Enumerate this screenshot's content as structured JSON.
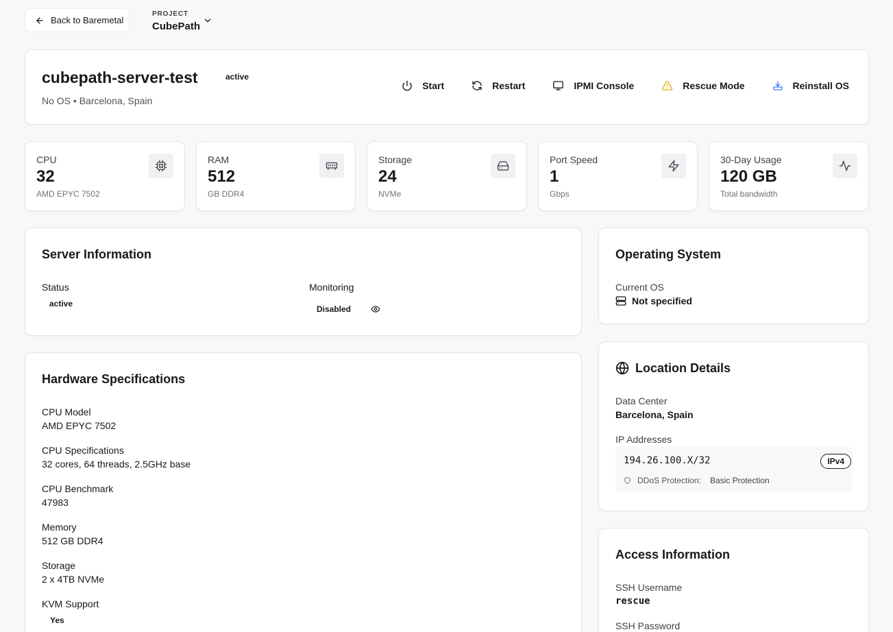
{
  "topbar": {
    "back_label": "Back to Baremetal",
    "project_label": "PROJECT",
    "project_name": "CubePath"
  },
  "server": {
    "name": "cubepath-server-test",
    "status": "active",
    "subtitle": "No OS • Barcelona, Spain"
  },
  "actions": [
    {
      "label": "Start",
      "icon": "power-icon"
    },
    {
      "label": "Restart",
      "icon": "refresh-icon"
    },
    {
      "label": "IPMI Console",
      "icon": "monitor-icon"
    },
    {
      "label": "Rescue Mode",
      "icon": "warning-icon"
    },
    {
      "label": "Reinstall OS",
      "icon": "download-icon"
    }
  ],
  "stats": [
    {
      "label": "CPU",
      "value": "32",
      "sub": "AMD EPYC 7502",
      "icon": "cpu-icon"
    },
    {
      "label": "RAM",
      "value": "512",
      "sub": "GB DDR4",
      "icon": "memory-icon"
    },
    {
      "label": "Storage",
      "value": "24",
      "sub": "NVMe",
      "icon": "hard-drive-icon"
    },
    {
      "label": "Port Speed",
      "value": "1",
      "sub": "Gbps",
      "icon": "lightning-icon"
    },
    {
      "label": "30-Day Usage",
      "value": "120 GB",
      "sub": "Total bandwidth",
      "icon": "activity-icon"
    }
  ],
  "server_info": {
    "title": "Server Information",
    "status_label": "Status",
    "status_value": "active",
    "monitoring_label": "Monitoring",
    "monitoring_value": "Disabled"
  },
  "hardware": {
    "title": "Hardware Specifications",
    "fields": [
      {
        "label": "CPU Model",
        "value": "AMD EPYC 7502"
      },
      {
        "label": "CPU Specifications",
        "value": "32 cores, 64 threads, 2.5GHz base"
      },
      {
        "label": "CPU Benchmark",
        "value": "47983"
      },
      {
        "label": "Memory",
        "value": "512 GB DDR4"
      },
      {
        "label": "Storage",
        "value": "2 x 4TB NVMe"
      },
      {
        "label": "KVM Support",
        "value": "Yes"
      }
    ]
  },
  "os": {
    "title": "Operating System",
    "current_label": "Current OS",
    "current_value": "Not specified"
  },
  "location": {
    "title": "Location Details",
    "dc_label": "Data Center",
    "dc_value": "Barcelona, Spain",
    "ip_label": "IP Addresses",
    "ip_value": "194.26.100.X/32",
    "ip_type": "IPv4",
    "ddos_label": "DDoS Protection:",
    "ddos_value": "Basic Protection"
  },
  "access": {
    "title": "Access Information",
    "ssh_user_label": "SSH Username",
    "ssh_user_value": "rescue",
    "ssh_pass_label": "SSH Password"
  },
  "colors": {
    "background": "#f8f8f9",
    "warning": "#eab308",
    "accent_blue": "#3b82f6"
  }
}
